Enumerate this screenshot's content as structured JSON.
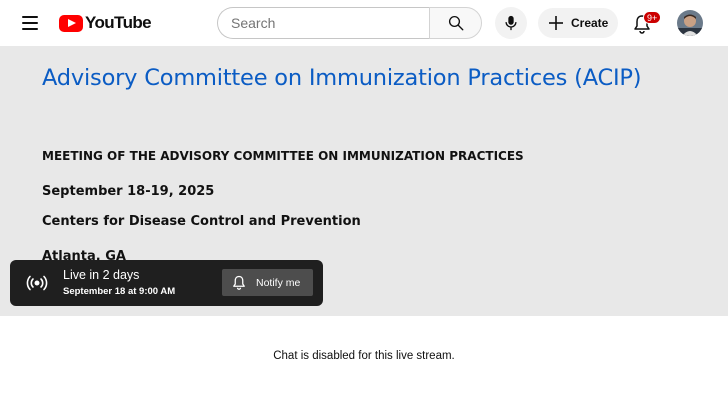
{
  "header": {
    "logo_text": "YouTube",
    "search_placeholder": "Search",
    "create_label": "Create",
    "notification_count": "9+"
  },
  "player": {
    "slide": {
      "title": "Advisory Committee on Immunization Practices (ACIP)",
      "lines": [
        "MEETING OF THE ADVISORY COMMITTEE ON IMMUNIZATION PRACTICES",
        "September 18-19, 2025",
        "Centers for Disease Control and Prevention",
        "Atlanta, GA"
      ]
    },
    "live_card": {
      "title": "Live in 2 days",
      "subtitle": "September 18 at 9:00 AM",
      "notify_label": "Notify me"
    }
  },
  "chat": {
    "notice": "Chat is disabled for this live stream."
  },
  "colors": {
    "brand_red": "#ff0000",
    "slide_title_blue": "#0b5cc4",
    "badge_red": "#cc0000"
  },
  "icons": [
    "menu-icon",
    "youtube-logo-icon",
    "search-icon",
    "mic-icon",
    "plus-icon",
    "bell-icon",
    "avatar",
    "live-broadcast-icon",
    "bell-icon"
  ]
}
